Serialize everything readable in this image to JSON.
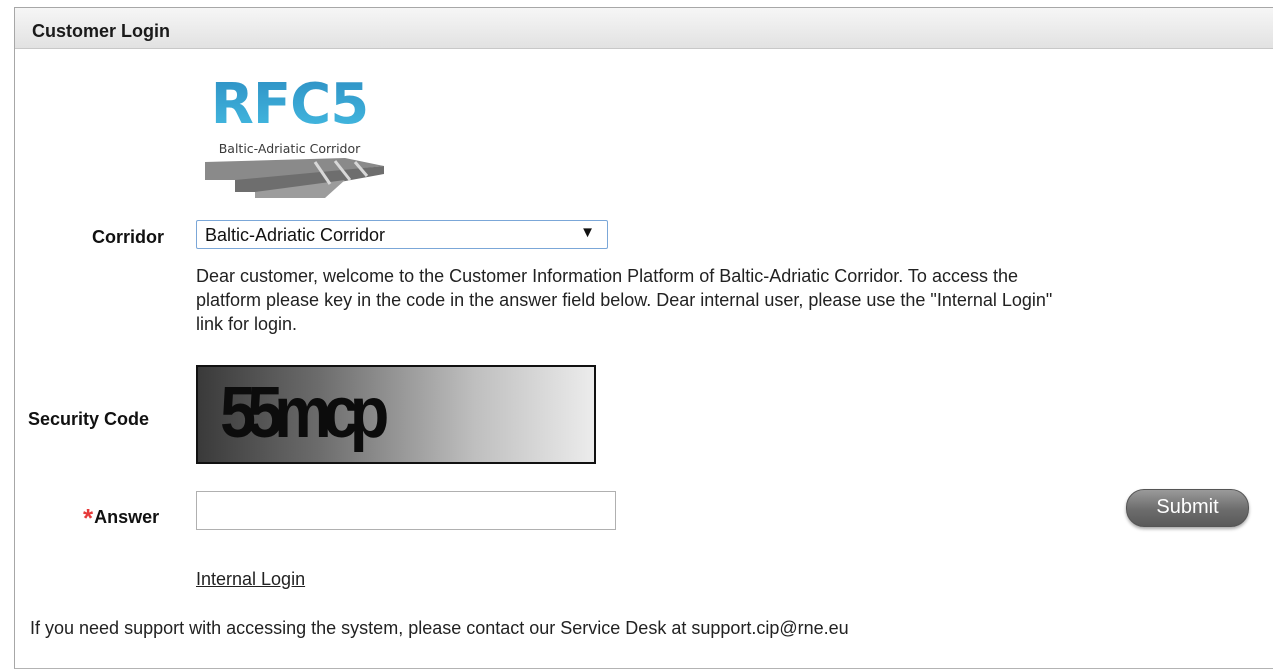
{
  "panel": {
    "title": "Customer Login"
  },
  "logo": {
    "text": "RFC5",
    "subtitle": "Baltic-Adriatic Corridor",
    "icon": "rail-tracks-logo"
  },
  "corridor": {
    "label": "Corridor",
    "selected": "Baltic-Adriatic Corridor",
    "arrow": "▼"
  },
  "welcome_text": "Dear customer, welcome to the Customer Information Platform of Baltic-Adriatic Corridor. To access the platform please key in the code in the answer field below. Dear internal user, please use the \"Internal Login\" link for login.",
  "security": {
    "label": "Security Code",
    "captcha": "55mcp"
  },
  "answer": {
    "required_mark": "*",
    "label": "Answer",
    "value": "",
    "placeholder": ""
  },
  "submit_label": "Submit",
  "internal_login_label": "Internal Login",
  "support_text": "If you need support with accessing the system, please contact our Service Desk at support.cip@rne.eu",
  "colors": {
    "required": "#e63a3a",
    "logo_blue": "#2d8fc3",
    "select_border": "#7ba7d8"
  }
}
